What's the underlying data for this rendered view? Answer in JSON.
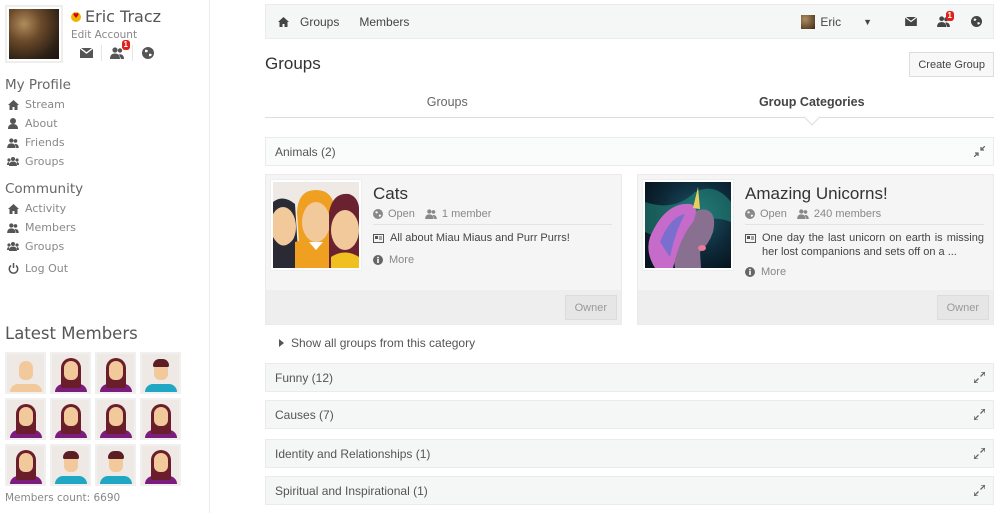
{
  "profile": {
    "name": "Eric Tracz",
    "edit_label": "Edit Account",
    "friend_requests_badge": "1",
    "icons": [
      "envelope-icon",
      "friends-icon",
      "globe-icon"
    ]
  },
  "sidebar": {
    "my_profile": {
      "title": "My Profile",
      "items": [
        {
          "label": "Stream",
          "icon": "home-icon"
        },
        {
          "label": "About",
          "icon": "user-icon"
        },
        {
          "label": "Friends",
          "icon": "friends-icon"
        },
        {
          "label": "Groups",
          "icon": "groups-icon"
        }
      ]
    },
    "community": {
      "title": "Community",
      "items": [
        {
          "label": "Activity",
          "icon": "home-icon"
        },
        {
          "label": "Members",
          "icon": "friends-icon"
        },
        {
          "label": "Groups",
          "icon": "groups-icon"
        }
      ]
    },
    "logout_label": "Log Out",
    "latest_members_title": "Latest Members",
    "latest_members": [
      "neutral",
      "female",
      "female",
      "male",
      "female",
      "female",
      "female",
      "female",
      "female",
      "male",
      "male",
      "female"
    ],
    "members_count_label": "Members count: 6690"
  },
  "topbar": {
    "links": [
      "Groups",
      "Members"
    ],
    "user_name": "Eric",
    "notification_badge": "1"
  },
  "page": {
    "title": "Groups",
    "create_button": "Create Group",
    "tabs": [
      {
        "label": "Groups",
        "active": false
      },
      {
        "label": "Group Categories",
        "active": true
      }
    ]
  },
  "categories": [
    {
      "label": "Animals (2)",
      "expanded": true
    },
    {
      "label": "Funny (12)",
      "expanded": false
    },
    {
      "label": "Causes (7)",
      "expanded": false
    },
    {
      "label": "Identity and Relationships (1)",
      "expanded": false
    },
    {
      "label": "Spiritual and Inspirational (1)",
      "expanded": false
    }
  ],
  "groups": [
    {
      "name": "Cats",
      "privacy": "Open",
      "members": "1 member",
      "description": "All about Miau Miaus and Purr Purrs!",
      "more": "More",
      "role": "Owner"
    },
    {
      "name": "Amazing Unicorns!",
      "privacy": "Open",
      "members": "240 members",
      "description": "One day the last unicorn on earth is missing her lost companions and sets off on a ...",
      "more": "More",
      "role": "Owner"
    }
  ],
  "show_all_label": "Show all groups from this category",
  "colors": {
    "badge": "#e0201b",
    "panel": "#f5f6f6",
    "text_muted": "#888888"
  }
}
